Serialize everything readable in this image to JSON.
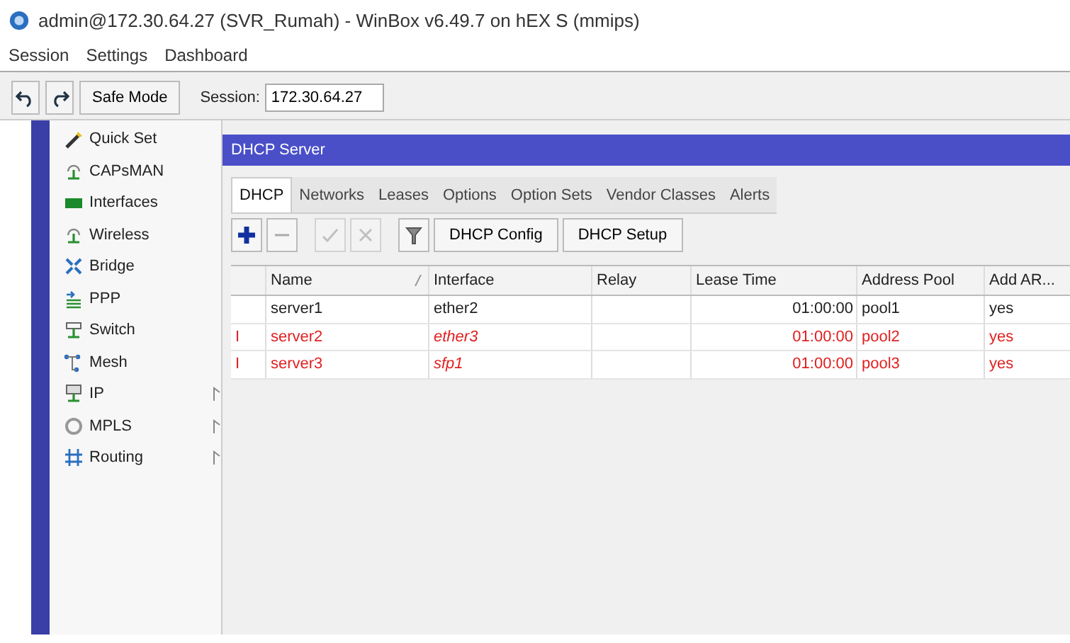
{
  "window": {
    "title": "admin@172.30.64.27 (SVR_Rumah) - WinBox v6.49.7 on hEX S (mmips)"
  },
  "menu": [
    "Session",
    "Settings",
    "Dashboard"
  ],
  "toolbar": {
    "safe_mode": "Safe Mode",
    "session_label": "Session:",
    "session_value": "172.30.64.27"
  },
  "sidebar": {
    "items": [
      {
        "label": "Quick Set",
        "submenu": false
      },
      {
        "label": "CAPsMAN",
        "submenu": false
      },
      {
        "label": "Interfaces",
        "submenu": false
      },
      {
        "label": "Wireless",
        "submenu": false
      },
      {
        "label": "Bridge",
        "submenu": false
      },
      {
        "label": "PPP",
        "submenu": false
      },
      {
        "label": "Switch",
        "submenu": false
      },
      {
        "label": "Mesh",
        "submenu": false
      },
      {
        "label": "IP",
        "submenu": true
      },
      {
        "label": "MPLS",
        "submenu": true
      },
      {
        "label": "Routing",
        "submenu": true
      }
    ]
  },
  "panel": {
    "title": "DHCP Server",
    "tabs": [
      {
        "label": "DHCP",
        "selected": true
      },
      {
        "label": "Networks",
        "selected": false
      },
      {
        "label": "Leases",
        "selected": false
      },
      {
        "label": "Options",
        "selected": false
      },
      {
        "label": "Option Sets",
        "selected": false
      },
      {
        "label": "Vendor Classes",
        "selected": false
      },
      {
        "label": "Alerts",
        "selected": false
      }
    ],
    "tools": [
      {
        "kind": "add",
        "disabled": false
      },
      {
        "kind": "remove",
        "disabled": false
      },
      {
        "kind": "enable",
        "disabled": true
      },
      {
        "kind": "disable",
        "disabled": true
      },
      {
        "kind": "filter",
        "disabled": false
      }
    ],
    "buttons": [
      "DHCP Config",
      "DHCP Setup"
    ],
    "table": {
      "columns": [
        "Name",
        "Interface",
        "Relay",
        "Lease Time",
        "Address Pool",
        "Add AR..."
      ],
      "rows": [
        {
          "flag": "",
          "disabled": false,
          "interface_invalid": false,
          "cells": [
            "server1",
            "ether2",
            "",
            "01:00:00",
            "pool1",
            "yes"
          ]
        },
        {
          "flag": "I",
          "disabled": true,
          "interface_invalid": true,
          "cells": [
            "server2",
            "ether3",
            "",
            "01:00:00",
            "pool2",
            "yes"
          ]
        },
        {
          "flag": "I",
          "disabled": true,
          "interface_invalid": true,
          "cells": [
            "server3",
            "sfp1",
            "",
            "01:00:00",
            "pool3",
            "yes"
          ]
        }
      ]
    }
  }
}
